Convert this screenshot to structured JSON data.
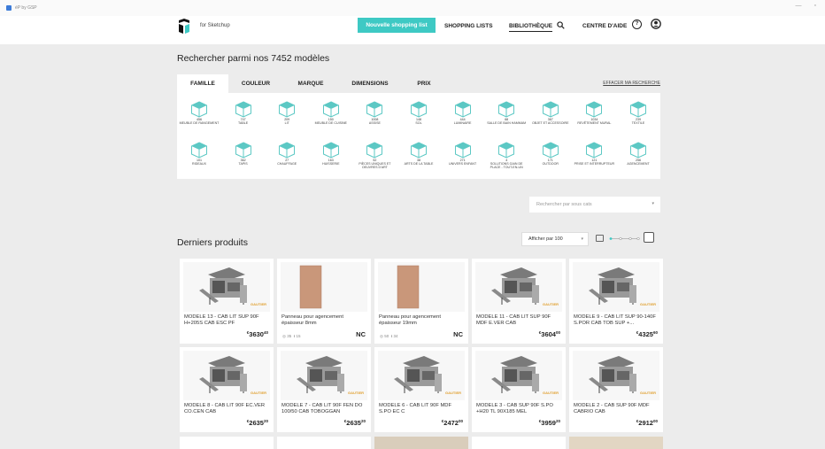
{
  "window": {
    "title": "éP by GSP",
    "controls": [
      "—",
      "▫",
      "×"
    ]
  },
  "header": {
    "logo_text": "for Sketchup",
    "new_list_label": "Nouvelle shopping list",
    "shopping_lists_label": "SHOPPING LISTS",
    "library_label": "BIBLIOTHÈQUE",
    "help_label": "CENTRE D'AIDE",
    "help_glyph": "?"
  },
  "search_title": "Rechercher parmi nos 7452 modèles",
  "tabs": [
    "FAMILLE",
    "COULEUR",
    "MARQUE",
    "DIMENSIONS",
    "PRIX"
  ],
  "reset_label": "EFFACER MA RECHERCHE",
  "categories": [
    {
      "count": "456",
      "label": "MEUBLE DE RANGEMENT"
    },
    {
      "count": "747",
      "label": "TABLE"
    },
    {
      "count": "209",
      "label": "LIT"
    },
    {
      "count": "150",
      "label": "MEUBLE DE CUISINE"
    },
    {
      "count": "1008",
      "label": "ASSISE"
    },
    {
      "count": "148",
      "label": "SOL"
    },
    {
      "count": "444",
      "label": "LUMINAIRE"
    },
    {
      "count": "68",
      "label": "SALLE DE BAIN HAMMAM"
    },
    {
      "count": "367",
      "label": "OBJET ET ACCESSOIRE"
    },
    {
      "count": "1034",
      "label": "REVÊTEMENT MURAL"
    },
    {
      "count": "239",
      "label": "TEXTILE"
    },
    {
      "count": "101",
      "label": "RIDEAUX"
    },
    {
      "count": "362",
      "label": "TAPIS"
    },
    {
      "count": "27",
      "label": "CHAUFFAGE"
    },
    {
      "count": "163",
      "label": "HUISSERIE"
    },
    {
      "count": "52",
      "label": "PIÈCES UNIQUES ET OEUVRES D'ART"
    },
    {
      "count": "38",
      "label": "ARTS DE LA TABLE"
    },
    {
      "count": "271",
      "label": "UNIVERS ENFANT"
    },
    {
      "count": "4",
      "label": "SOLUTIONS GAIN DE PLACE - TOUT-EN-UN"
    },
    {
      "count": "171",
      "label": "OUTDOOR"
    },
    {
      "count": "121",
      "label": "PRISE ET INTERRUPTEUR"
    },
    {
      "count": "256",
      "label": "AGENCEMENT"
    }
  ],
  "room_search_placeholder": "Rechercher par sous cats",
  "products_title": "Derniers produits",
  "per_page_label": "Afficher par 100",
  "products": [
    {
      "name": "MODÈLE 13 - CAB LIT SUP 90F H+205S CAB ESC PF",
      "price": "3630",
      "cents": "40",
      "kind": "bed"
    },
    {
      "name": "Panneau pour agencement épaisseur 8mm",
      "price": "NC",
      "views": "35",
      "downloads": "15",
      "kind": "panel"
    },
    {
      "name": "Panneau pour agencement épaisseur 19mm",
      "price": "NC",
      "views": "50",
      "downloads": "34",
      "kind": "panel"
    },
    {
      "name": "MODÈLE 11 - CAB LIT SUP 90F MDF E.VER CAB",
      "price": "3604",
      "cents": "00",
      "kind": "bed"
    },
    {
      "name": "MODÈLE 9 - CAB LIT SUP 90-140F S.POR CAB TOB SUP +...",
      "price": "4325",
      "cents": "60",
      "kind": "bed"
    },
    {
      "name": "MODÈLE 8 - CAB LIT 90F EC.VER CO.CEN CAB",
      "price": "2635",
      "cents": "20",
      "kind": "bed"
    },
    {
      "name": "MODÈLE 7 - CAB LIT 90F FEN DO 100/50 CAB TOBOGGAN",
      "price": "2635",
      "cents": "20",
      "kind": "bed"
    },
    {
      "name": "MODÈLE 6 - CAB LIT 90F MDF S.PO EC C",
      "price": "2472",
      "cents": "00",
      "kind": "bed"
    },
    {
      "name": "MODÈLE 3 - CAB SUP 90F S.PO +H20 TL 90X185 MEL",
      "price": "3959",
      "cents": "20",
      "kind": "bed"
    },
    {
      "name": "MODÈLE 2 - CAB SUP 90F MDF CABRIO CAB",
      "price": "2912",
      "cents": "00",
      "kind": "bed"
    }
  ],
  "brand_tag": "GAUTIER",
  "currency": "€",
  "colors": {
    "accent": "#3ec9c4",
    "category_icon": "#5cc8c4"
  }
}
